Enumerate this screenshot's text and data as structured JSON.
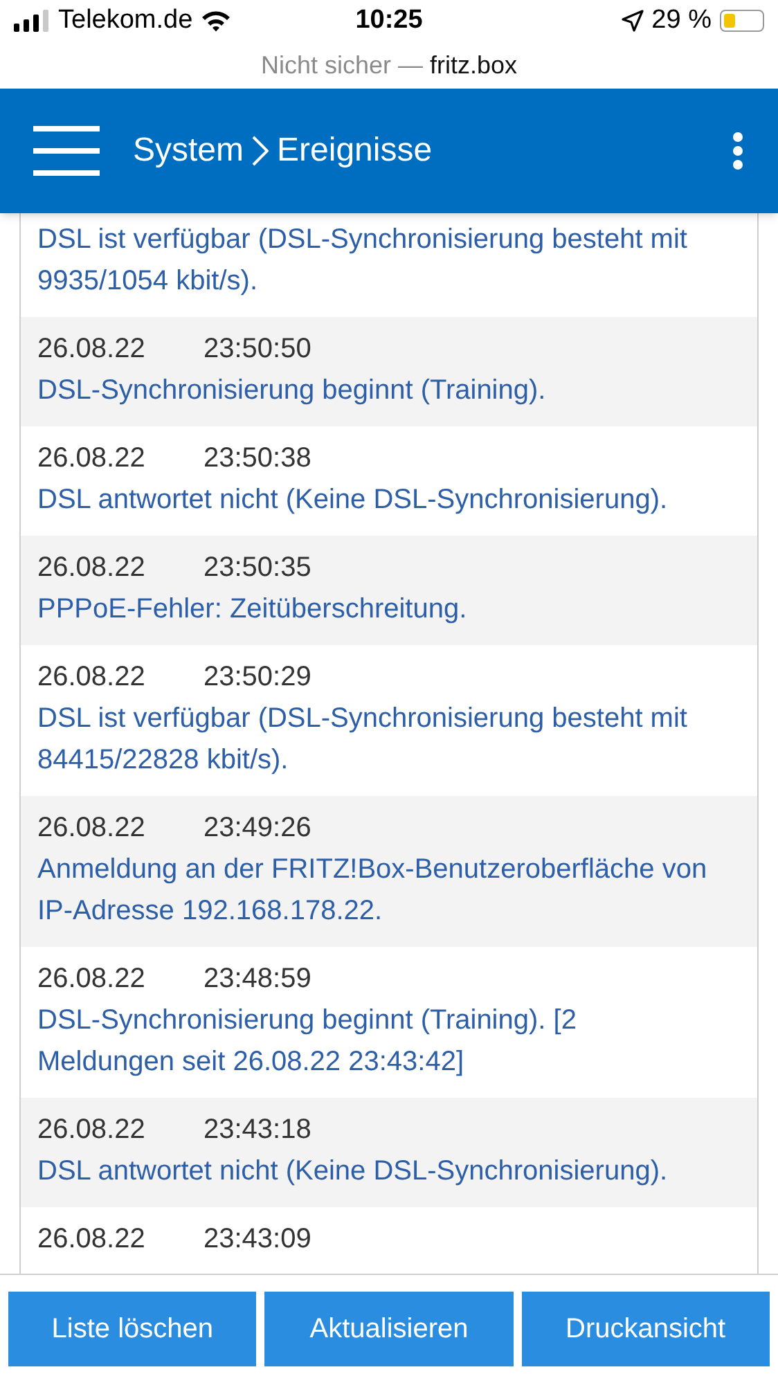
{
  "status_bar": {
    "carrier": "Telekom.de",
    "time": "10:25",
    "battery": "29 %"
  },
  "browser": {
    "security": "Nicht sicher —",
    "host": "fritz.box"
  },
  "header": {
    "section": "System",
    "page": "Ereignisse"
  },
  "events": [
    {
      "message": "DSL ist verfügbar (DSL-Synchronisierung besteht mit 9935/1054 kbit/s)."
    },
    {
      "date": "26.08.22",
      "time": "23:50:50",
      "message": "DSL-Synchronisierung beginnt (Training)."
    },
    {
      "date": "26.08.22",
      "time": "23:50:38",
      "message": "DSL antwortet nicht (Keine DSL-Synchronisierung)."
    },
    {
      "date": "26.08.22",
      "time": "23:50:35",
      "message": "PPPoE-Fehler: Zeitüberschreitung."
    },
    {
      "date": "26.08.22",
      "time": "23:50:29",
      "message": "DSL ist verfügbar (DSL-Synchronisierung besteht mit 84415/22828 kbit/s)."
    },
    {
      "date": "26.08.22",
      "time": "23:49:26",
      "message": "Anmeldung an der FRITZ!Box-Benutzeroberfläche von IP-Adresse 192.168.178.22."
    },
    {
      "date": "26.08.22",
      "time": "23:48:59",
      "message": "DSL-Synchronisierung beginnt (Training). [2 Meldungen seit 26.08.22 23:43:42]"
    },
    {
      "date": "26.08.22",
      "time": "23:43:18",
      "message": "DSL antwortet nicht (Keine DSL-Synchronisierung)."
    },
    {
      "date": "26.08.22",
      "time": "23:43:09"
    }
  ],
  "buttons": [
    "Liste löschen",
    "Aktualisieren",
    "Druckansicht"
  ]
}
